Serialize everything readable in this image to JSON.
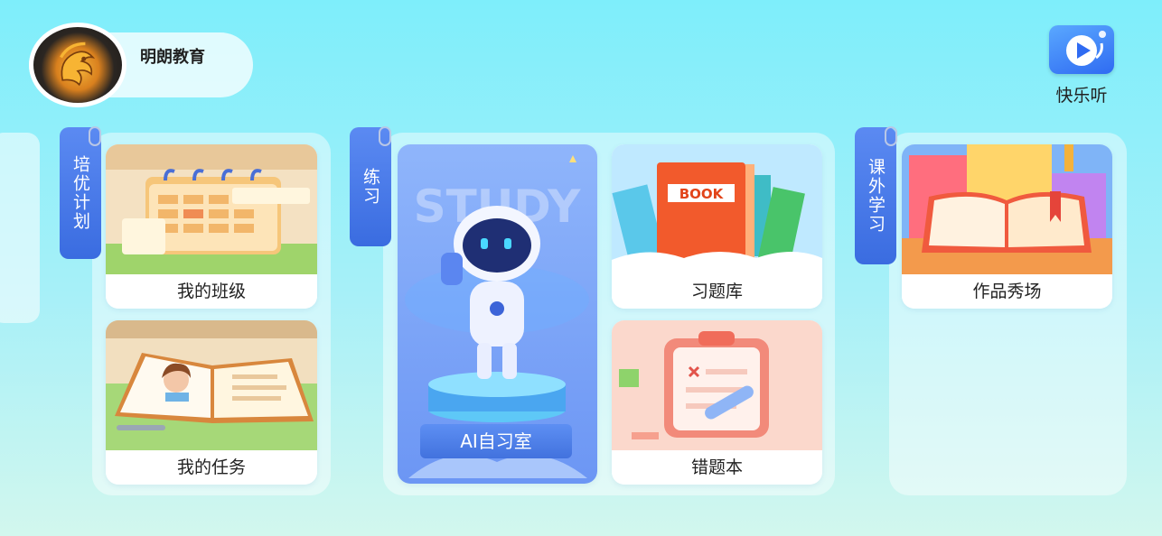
{
  "header": {
    "school_name": "明朗教育",
    "quick_listen_label": "快乐听"
  },
  "sections": {
    "training_plan": {
      "tab_label": "培优计划",
      "cards": [
        {
          "label": "我的班级",
          "icon": "calendar-illustration"
        },
        {
          "label": "我的任务",
          "icon": "open-book-illustration"
        }
      ]
    },
    "practice": {
      "tab_label": "练习",
      "cards": [
        {
          "label": "AI自习室",
          "icon": "robot-astronaut-illustration",
          "bg_word": "STUDY"
        },
        {
          "label": "习题库",
          "icon": "books-illustration",
          "book_word": "BOOK"
        },
        {
          "label": "错题本",
          "icon": "clipboard-illustration"
        }
      ]
    },
    "extracurricular": {
      "tab_label": "课外学习",
      "cards": [
        {
          "label": "作品秀场",
          "icon": "stage-book-illustration"
        }
      ]
    }
  },
  "colors": {
    "tab_blue": "#4A7BE8",
    "bg_top": "#7EEEFB",
    "bg_bottom": "#D2F7EE"
  }
}
